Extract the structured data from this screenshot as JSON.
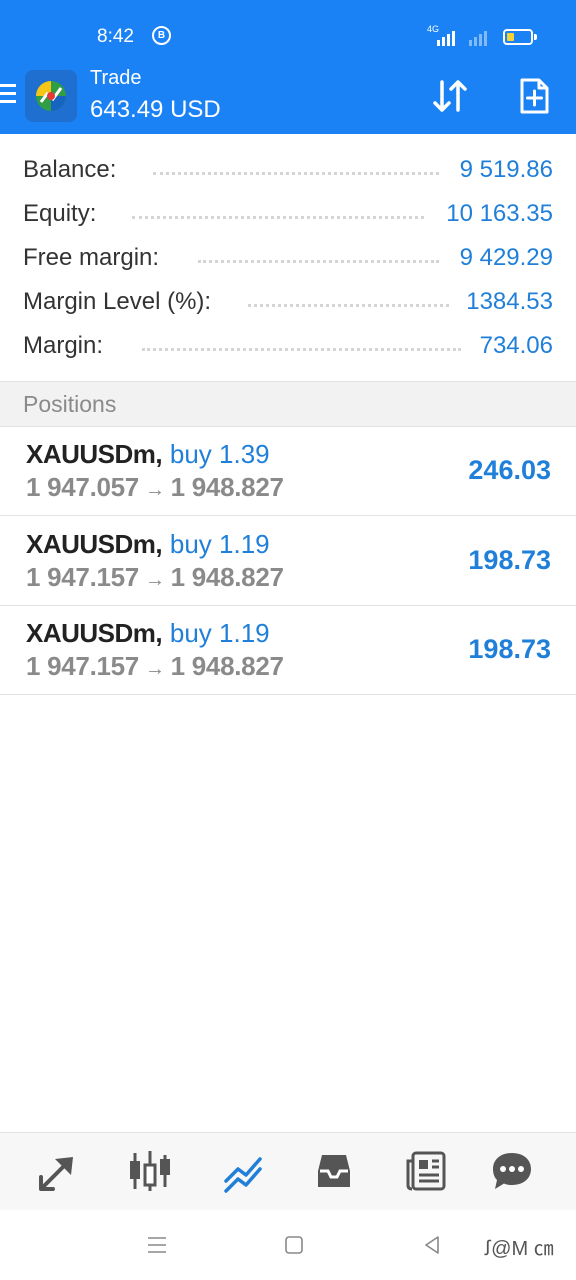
{
  "status_bar": {
    "time": "8:42",
    "notification_badge": "B",
    "network_label": "4G",
    "battery_level": 0.3,
    "battery_color": "#f5d23a"
  },
  "header": {
    "title": "Trade",
    "subtitle": "643.49 USD",
    "background_color": "#1a82f5",
    "logo_icon": "metatrader-logo-icon",
    "sort_icon": "sort-arrows-icon",
    "new_order_icon": "new-order-icon"
  },
  "summary": [
    {
      "label": "Balance:",
      "value": "9 519.86"
    },
    {
      "label": "Equity:",
      "value": "10 163.35"
    },
    {
      "label": "Free margin:",
      "value": "9 429.29"
    },
    {
      "label": "Margin Level (%):",
      "value": "1384.53"
    },
    {
      "label": "Margin:",
      "value": "734.06"
    }
  ],
  "positions_section": {
    "label": "Positions"
  },
  "positions": [
    {
      "symbol": "XAUUSDm",
      "separator": ",",
      "side": "buy 1.39",
      "open_price": "1 947.057",
      "arrow": "→",
      "current_price": "1 948.827",
      "profit": "246.03"
    },
    {
      "symbol": "XAUUSDm",
      "separator": ",",
      "side": "buy 1.19",
      "open_price": "1 947.157",
      "arrow": "→",
      "current_price": "1 948.827",
      "profit": "198.73"
    },
    {
      "symbol": "XAUUSDm",
      "separator": ",",
      "side": "buy 1.19",
      "open_price": "1 947.157",
      "arrow": "→",
      "current_price": "1 948.827",
      "profit": "198.73"
    }
  ],
  "tabbar": {
    "tabs": [
      {
        "name": "quotes",
        "icon": "quotes-arrows-icon"
      },
      {
        "name": "chart",
        "icon": "candlestick-icon"
      },
      {
        "name": "trade",
        "icon": "trade-lines-icon",
        "active": true
      },
      {
        "name": "history",
        "icon": "inbox-tray-icon"
      },
      {
        "name": "news",
        "icon": "newspaper-icon"
      },
      {
        "name": "messages",
        "icon": "chat-bubble-icon"
      }
    ],
    "active_color": "#1f7fd9"
  },
  "navbar": {
    "icons": [
      "menu-lines-icon",
      "home-square-icon",
      "back-triangle-icon"
    ],
    "watermark": "ꭍ@M ㎝"
  }
}
